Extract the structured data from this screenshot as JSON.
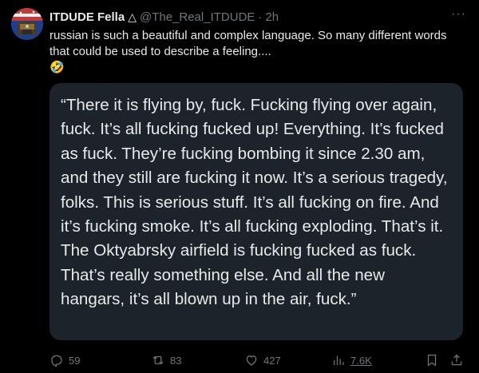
{
  "post": {
    "author": {
      "display_name": "ITDUDE Fella",
      "badge_symbol": "△",
      "handle": "@The_Real_ITDUDE",
      "separator": "·",
      "time": "2h"
    },
    "more_label": "···",
    "text": "russian is such a beautiful and complex language. So many different words that could be used to describe a feeling....",
    "emoji": "🤣",
    "quote": "“There it is flying by, fuck. Fucking flying over again, fuck. It’s all fucking fucked up! Everything. It’s fucked as fuck. They’re fucking bombing it since 2.30 am, and they still are fucking it now. It’s a serious tragedy, folks. This is serious stuff. It’s all fucking on fire. And it’s fucking smoke. It’s all fucking exploding. That’s it. The Oktyabrsky airfield is fucking fucked as fuck. That’s really something else. And all the new hangars, it’s all blown up in the air, fuck.”",
    "actions": {
      "replies": "59",
      "reposts": "83",
      "likes": "427",
      "views": "7.6K"
    }
  },
  "icons": {
    "reply": "reply-icon",
    "repost": "repost-icon",
    "like": "heart-icon",
    "views": "views-icon",
    "bookmark": "bookmark-icon",
    "share": "share-icon"
  },
  "colors": {
    "background": "#000000",
    "quote_background": "#1d232b",
    "text": "#e7e9ea",
    "muted": "#71767b"
  }
}
